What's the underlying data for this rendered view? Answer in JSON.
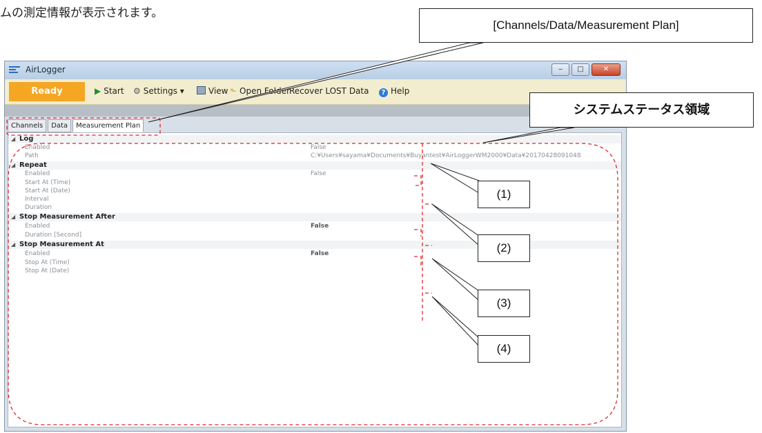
{
  "doc_text": "ムの測定情報が表示されます。",
  "window": {
    "title": "AirLogger",
    "buttons": {
      "minimize": "‒",
      "maximize": "□",
      "close": "✕"
    }
  },
  "toolbar": {
    "status": "Ready",
    "status_color": "#f5a623",
    "start": "Start",
    "settings": "Settings ▾",
    "view": "View",
    "open_folder": "Open Folder",
    "recover": "Recover LOST Data",
    "help": "Help"
  },
  "tabs": [
    {
      "label": "Channels"
    },
    {
      "label": "Data"
    },
    {
      "label": "Measurement Plan"
    }
  ],
  "grid": {
    "log": {
      "title": "Log",
      "enabled_label": "Enabled",
      "enabled_value": "False",
      "path_label": "Path",
      "path_value": "C:¥Users¥sayama¥Documents¥Buyantest¥AirLoggerWM2000¥Data¥20170428091048"
    },
    "repeat": {
      "title": "Repeat",
      "enabled_label": "Enabled",
      "enabled_value": "False",
      "start_time_label": "Start At (Time)",
      "start_date_label": "Start At (Date)",
      "interval_label": "Interval",
      "duration_label": "Duration"
    },
    "stop_after": {
      "title": "Stop Measurement After",
      "enabled_label": "Enabled",
      "enabled_value": "False",
      "duration_label": "Duration [Second]"
    },
    "stop_at": {
      "title": "Stop Measurement At",
      "enabled_label": "Enabled",
      "enabled_value": "False",
      "time_label": "Stop At (Time)",
      "date_label": "Stop At (Date)"
    }
  },
  "callouts": {
    "top": "[Channels/Data/Measurement Plan]",
    "system": "システムステータス領域",
    "n1": "(1)",
    "n2": "(2)",
    "n3": "(3)",
    "n4": "(4)"
  },
  "colors": {
    "dashed": "#e0262a"
  }
}
